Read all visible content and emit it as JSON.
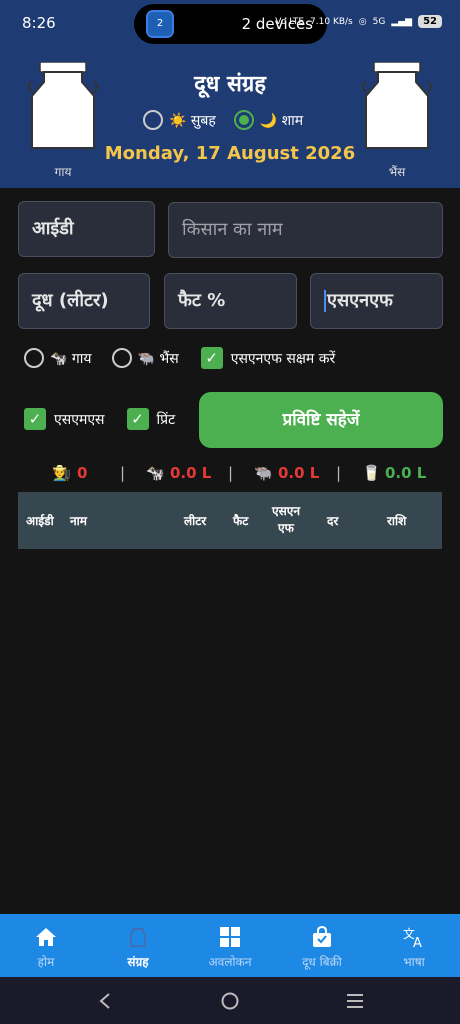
{
  "status": {
    "time": "8:26",
    "pill_text": "2 devices",
    "pill_badge": "2",
    "net": "Vo LTE",
    "speed": "7.10 KB/s",
    "signal": "5G",
    "battery": "52"
  },
  "header": {
    "title": "दूध संग्रह",
    "morning_label": "☀️ सुबह",
    "evening_label": "🌙 शाम",
    "selected_session": "evening",
    "date": "Monday, 17 August 2026",
    "cow_label": "गाय",
    "buffalo_label": "भैंस"
  },
  "form": {
    "id_label": "आईडी",
    "farmer_placeholder": "किसान का नाम",
    "milk_label": "दूध (लीटर)",
    "fat_label": "फैट %",
    "snf_label": "एसएनएफ"
  },
  "options": {
    "cow_label": "🐄 गाय",
    "buffalo_label": "🐃 भैंस",
    "snf_enable_label": "एसएनएफ सक्षम करें",
    "snf_enabled": true,
    "sms_label": "एसएमएस",
    "sms_checked": true,
    "print_label": "प्रिंट",
    "print_checked": true,
    "save_button": "प्रविष्टि सहेजें"
  },
  "summary": {
    "farmer_icon": "👨‍🌾",
    "farmer_count": "0",
    "cow_icon": "🐄",
    "cow_total": "0.0 L",
    "buffalo_icon": "🐃",
    "buffalo_total": "0.0 L",
    "milk_icon": "🥛",
    "milk_total": "0.0 L",
    "sep": "|"
  },
  "table": {
    "columns": [
      "आईडी",
      "नाम",
      "लीटर",
      "फैट",
      "एसएन एफ",
      "दर",
      "राशि"
    ]
  },
  "nav": [
    {
      "label": "होम",
      "icon": "home-icon",
      "active": false
    },
    {
      "label": "संग्रह",
      "icon": "collection-icon",
      "active": true
    },
    {
      "label": "अवलोकन",
      "icon": "grid-icon",
      "active": false
    },
    {
      "label": "दूध बिक्री",
      "icon": "shopping-bag-icon",
      "active": false
    },
    {
      "label": "भाषा",
      "icon": "translate-icon",
      "active": false
    }
  ],
  "colors": {
    "header": "#1f3b73",
    "accent_green": "#4caf50",
    "date_yellow": "#f3c64b",
    "cow_red": "#e53935",
    "total_green": "#4caf50",
    "nav_blue": "#1e88e5"
  }
}
